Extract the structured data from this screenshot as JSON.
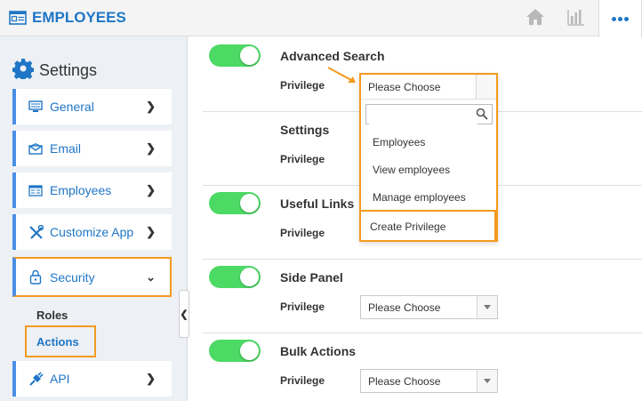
{
  "header": {
    "app_title": "EMPLOYEES",
    "buttons": [
      {
        "icon": "home-icon"
      },
      {
        "icon": "bar-chart-icon"
      },
      {
        "icon": "more-icon"
      }
    ]
  },
  "sidebar": {
    "title": "Settings",
    "items": [
      {
        "label": "General",
        "icon": "monitor-icon"
      },
      {
        "label": "Email",
        "icon": "envelope-icon"
      },
      {
        "label": "Employees",
        "icon": "id-card-icon"
      },
      {
        "label": "Customize App",
        "icon": "tools-icon"
      },
      {
        "label": "Security",
        "icon": "lock-icon",
        "expanded": true
      },
      {
        "label": "API",
        "icon": "plug-icon"
      }
    ],
    "security_subitems": [
      {
        "label": "Roles"
      },
      {
        "label": "Actions",
        "selected": true
      }
    ]
  },
  "main": {
    "privilege_label": "Privilege",
    "sections": [
      {
        "title": "Advanced Search",
        "toggle_on": true,
        "privilege": "Please Choose"
      },
      {
        "title": "Settings",
        "toggle_on": false,
        "privilege": ""
      },
      {
        "title": "Useful Links",
        "toggle_on": true,
        "privilege": ""
      },
      {
        "title": "Side Panel",
        "toggle_on": true,
        "privilege": "Please Choose"
      },
      {
        "title": "Bulk Actions",
        "toggle_on": true,
        "privilege": "Please Choose"
      }
    ],
    "dropdown": {
      "selected": "Please Choose",
      "search_value": "",
      "options": [
        "Employees",
        "View employees",
        "Manage employees"
      ],
      "create_label": "Create Privilege"
    }
  },
  "colors": {
    "accent": "#1f76c6",
    "highlight": "#f39a1f",
    "toggle_on": "#4cd964",
    "nav_border": "#4a8ee6"
  }
}
